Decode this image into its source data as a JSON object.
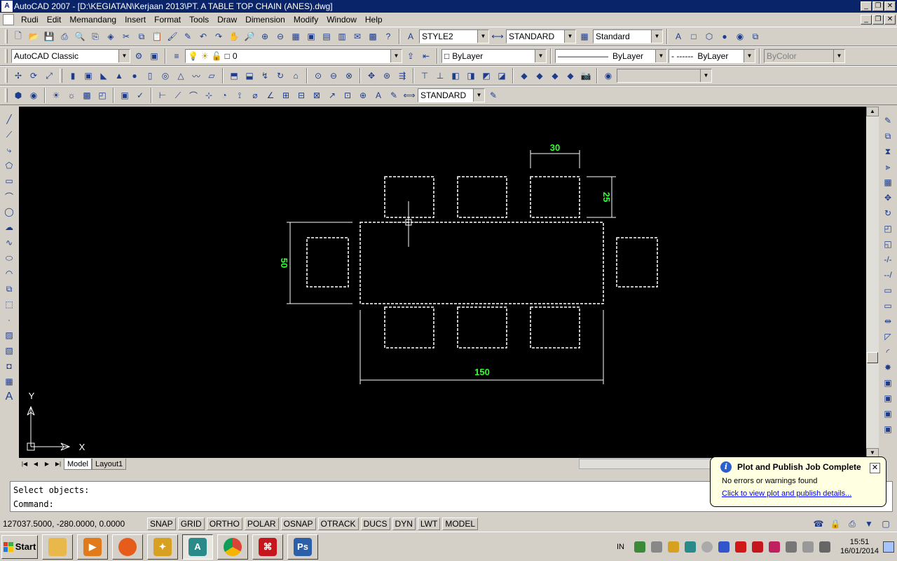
{
  "window": {
    "title": "AutoCAD 2007 - [D:\\KEGIATAN\\Kerjaan 2013\\PT. A TABLE TOP CHAIN (ANES).dwg]"
  },
  "menu": [
    "Rudi",
    "Edit",
    "Memandang",
    "Insert",
    "Format",
    "Tools",
    "Draw",
    "Dimension",
    "Modify",
    "Window",
    "Help"
  ],
  "toolbar": {
    "text_style": "STYLE2",
    "dim_style": "STANDARD",
    "table_style": "Standard",
    "workspace": "AutoCAD Classic",
    "layer": "0",
    "color": "ByLayer",
    "linetype": "ByLayer",
    "lineweight": "ByLayer",
    "plotstyle": "ByColor",
    "dim_style2": "STANDARD"
  },
  "drawing": {
    "dimensions": {
      "top": "30",
      "right": "25",
      "left": "50",
      "bottom": "150"
    },
    "ucs": {
      "x_label": "X",
      "y_label": "Y"
    },
    "colors": {
      "background": "#000000",
      "geometry": "#ffffff",
      "dimension_text": "#33ff33"
    }
  },
  "tabs": {
    "model": "Model",
    "layout1": "Layout1"
  },
  "command": {
    "line1": "Select objects:",
    "line2": "Command:"
  },
  "status": {
    "coords": "127037.5000, -280.0000, 0.0000",
    "buttons": [
      "SNAP",
      "GRID",
      "ORTHO",
      "POLAR",
      "OSNAP",
      "OTRACK",
      "DUCS",
      "DYN",
      "LWT",
      "MODEL"
    ]
  },
  "notification": {
    "title": "Plot and Publish Job Complete",
    "message": "No errors or warnings found",
    "link": "Click to view plot and publish details..."
  },
  "taskbar": {
    "start_label": "Start",
    "apps": [
      {
        "name": "file-explorer",
        "color": "#e8b84a",
        "label": ""
      },
      {
        "name": "media-player",
        "color": "#e07a1a",
        "label": ""
      },
      {
        "name": "firefox",
        "color": "#e65c1a",
        "label": ""
      },
      {
        "name": "utility",
        "color": "#d8a020",
        "label": ""
      },
      {
        "name": "autocad",
        "color": "#2a8a8a",
        "label": "A",
        "active": true
      },
      {
        "name": "chrome",
        "color": "#2e9e44",
        "label": ""
      },
      {
        "name": "acrobat",
        "color": "#c4161c",
        "label": ""
      },
      {
        "name": "photoshop",
        "color": "#2b5fa8",
        "label": "Ps"
      }
    ],
    "lang": "IN",
    "time": "15:51",
    "date": "16/01/2014"
  }
}
